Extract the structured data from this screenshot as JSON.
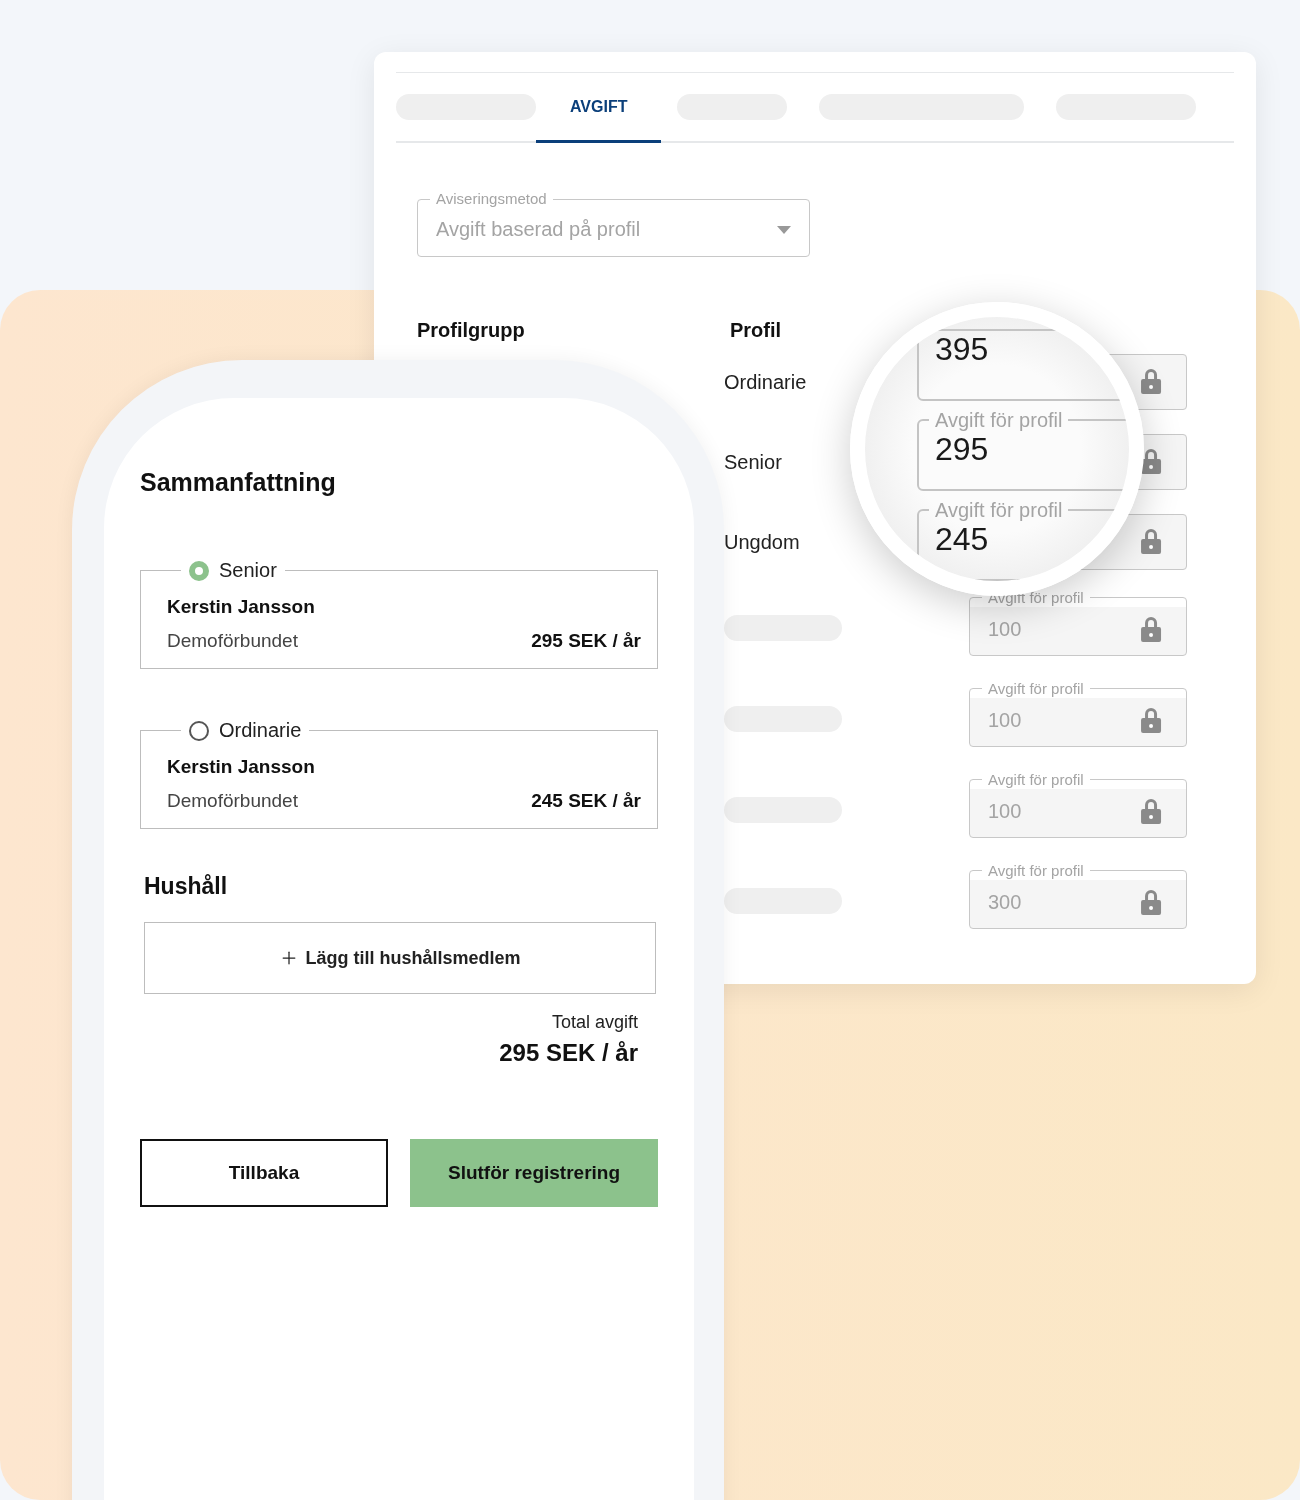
{
  "admin": {
    "tabs": [
      {
        "kind": "skeleton",
        "selected": false
      },
      {
        "kind": "text",
        "label": "AVGIFT",
        "selected": true
      },
      {
        "kind": "skeleton",
        "selected": false
      },
      {
        "kind": "skeleton",
        "selected": false
      },
      {
        "kind": "skeleton",
        "selected": false
      }
    ],
    "select": {
      "label": "Aviseringsmetod",
      "value": "Avgift baserad på profil"
    },
    "columns": [
      "Profilgrupp",
      "Profil"
    ],
    "rows": [
      {
        "kind": "named",
        "profile": "Ordinarie"
      },
      {
        "kind": "named",
        "profile": "Senior"
      },
      {
        "kind": "named",
        "profile": "Ungdom"
      },
      {
        "kind": "skeleton",
        "fee_label": "Avgift för profil",
        "fee": "100"
      },
      {
        "kind": "skeleton",
        "fee_label": "Avgift för profil",
        "fee": "100"
      },
      {
        "kind": "skeleton",
        "fee_label": "Avgift för profil",
        "fee": "100"
      },
      {
        "kind": "skeleton",
        "fee_label": "Avgift för profil",
        "fee": "300"
      }
    ]
  },
  "magnifier": {
    "fields": [
      {
        "value": "395"
      },
      {
        "label": "Avgift för profil",
        "value": "295"
      },
      {
        "label": "Avgift för profil",
        "value": "245"
      }
    ]
  },
  "phone": {
    "title": "Sammanfattning",
    "options": [
      {
        "label": "Senior",
        "selected": true,
        "name": "Kerstin Jansson",
        "org": "Demoförbundet",
        "price": "295 SEK / år"
      },
      {
        "label": "Ordinarie",
        "selected": false,
        "name": "Kerstin Jansson",
        "org": "Demoförbundet",
        "price": "245 SEK / år"
      }
    ],
    "household_title": "Hushåll",
    "add_button": "Lägg till hushållsmedlem",
    "total_label": "Total avgift",
    "total": "295 SEK / år",
    "buttons": [
      {
        "kind": "secondary",
        "label": "Tillbaka"
      },
      {
        "kind": "primary",
        "label": "Slutför registrering"
      }
    ]
  }
}
